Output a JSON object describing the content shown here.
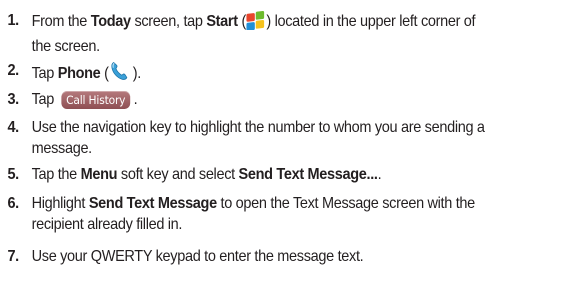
{
  "steps": [
    {
      "num": "1.",
      "t1": "From the ",
      "b1": "Today",
      "t2": " screen, tap ",
      "b2": "Start",
      "t3": " (",
      "icon": "windows-start-icon",
      "t4": ") located in the upper left corner of",
      "t5": "the screen."
    },
    {
      "num": "2.",
      "t1": "Tap ",
      "b1": "Phone",
      "t2": " (",
      "icon": "phone-icon",
      "t3": " )."
    },
    {
      "num": "3.",
      "t1": "Tap",
      "button": "Call History",
      "t2": "."
    },
    {
      "num": "4.",
      "t1": "Use the navigation key to highlight the number to whom you are sending a",
      "t2": "message."
    },
    {
      "num": "5.",
      "t1": "Tap the ",
      "b1": "Menu",
      "t2": " soft key and select ",
      "b2": "Send Text Message...",
      "t3": "."
    },
    {
      "num": "6.",
      "t1": "Highlight ",
      "b1": "Send Text Message",
      "t2": " to open the Text Message screen with the",
      "t3": "recipient already filled in."
    },
    {
      "num": "7.",
      "t1": "Use your QWERTY keypad to enter the message text."
    }
  ],
  "colors": {
    "text": "#231f20",
    "button_bg": "#9c5f63",
    "phone_icon": "#3aa0d8"
  }
}
